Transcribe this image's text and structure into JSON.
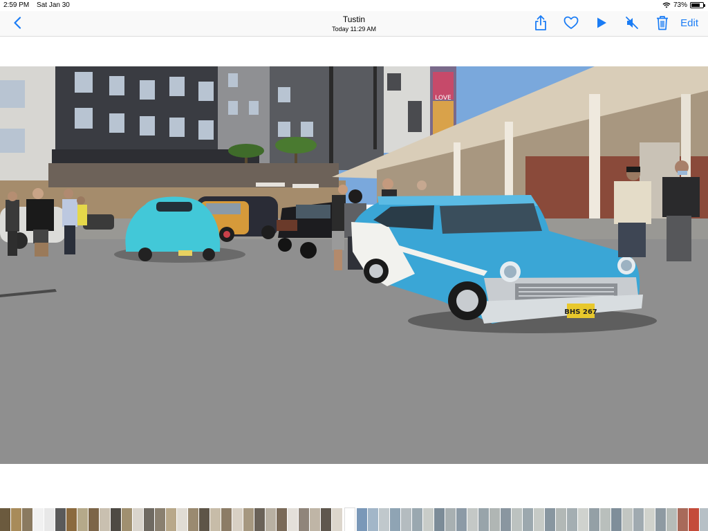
{
  "status": {
    "time": "2:59 PM",
    "date": "Sat Jan 30",
    "battery": "73%",
    "battery_level": 0.73
  },
  "nav": {
    "title": "Tustin",
    "subtitle": "Today  11:29 AM",
    "edit_label": "Edit",
    "icons": [
      "chevron-left-icon",
      "share-icon",
      "heart-icon",
      "play-icon",
      "speaker-muted-icon",
      "trash-icon"
    ],
    "accent": "#1a7cf5"
  },
  "photo": {
    "signs": {
      "mural": "LOVE",
      "plate": "BHS 267"
    }
  },
  "filmstrip": {
    "colors_a": [
      "#6b5a3e",
      "#a88b5a",
      "#8a7a60",
      "#f1f1f1",
      "#e8e8e8",
      "#5a5a5a",
      "#8b6a3e",
      "#b5a98a",
      "#7c6548",
      "#c9c0b0",
      "#4e4a44",
      "#a09070",
      "#d9d4cc",
      "#6f6a62",
      "#8a8070",
      "#b8a88a",
      "#e0dcd4",
      "#9a8a70",
      "#5e5548",
      "#c7bca8",
      "#8c7c66",
      "#d8d0c4",
      "#a69880",
      "#6a6258",
      "#b8b0a2",
      "#7a6a58",
      "#e4e0da",
      "#90857a",
      "#bfb5a6",
      "#5f574e",
      "#dcd6cc"
    ],
    "colors_b": [
      "#7a98b8",
      "#a2b6c8",
      "#c0c8cc",
      "#8fa4b4",
      "#b4bcc0",
      "#9aa8b0",
      "#c8ccc8",
      "#7c8c98",
      "#a8b0b2",
      "#8c9aa6",
      "#c4c8c6",
      "#98a4aa",
      "#b0b6b4",
      "#8a96a0",
      "#bcc2c0",
      "#9ca8ae",
      "#c6cac6",
      "#8896a0",
      "#b2b8b6",
      "#a4aeb2",
      "#cfd2ce",
      "#94a0a6",
      "#b9bfbc",
      "#7f8e9a",
      "#c2c6c2",
      "#a0aab0",
      "#d0d2cc",
      "#8e9aa2",
      "#b6bcb8",
      "#a86a5a",
      "#c44b3a",
      "#b7c0c6"
    ]
  }
}
